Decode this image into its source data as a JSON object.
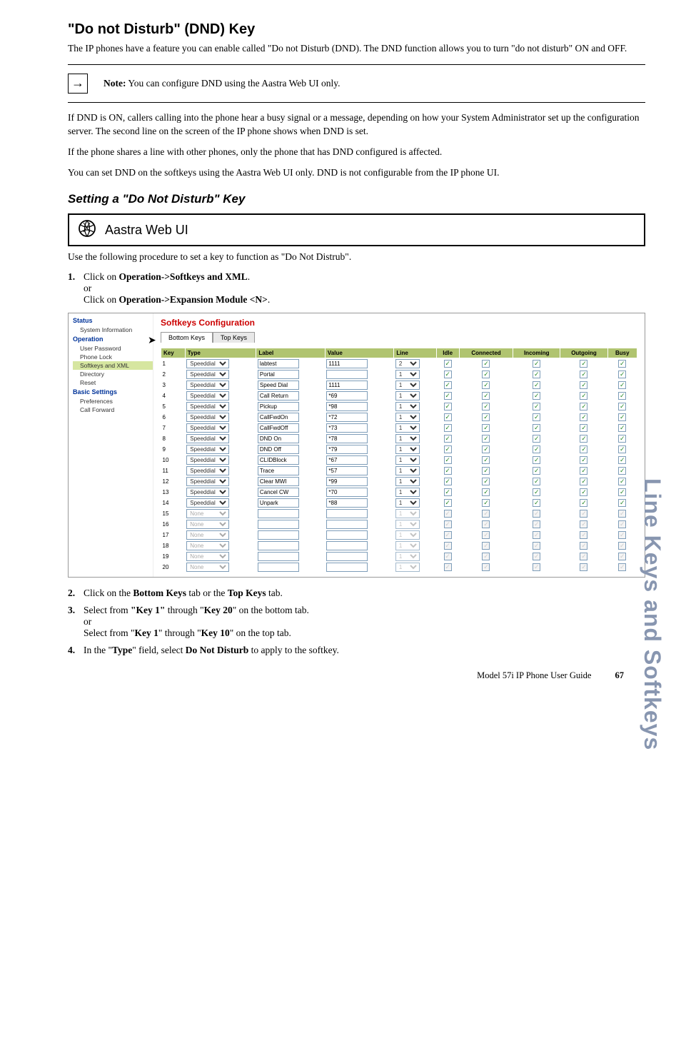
{
  "title": "\"Do not Disturb\" (DND) Key",
  "intro": "The IP phones have a feature you can enable called \"Do not Disturb (DND). The DND function allows you to turn \"do not disturb\" ON and OFF.",
  "note_glyph": "→",
  "note_label": "Note:",
  "note_text": " You can configure DND using the Aastra Web UI only.",
  "p1": "If DND is ON, callers calling into the phone hear a busy signal or a message, depending on how your System Administrator set up the configuration server. The second line on the screen of the IP phone shows when DND is set.",
  "p2": "If the phone shares a line with other phones, only the phone that has DND configured is affected.",
  "p3": "You can set DND on the softkeys using the Aastra Web UI only. DND is not configurable from the IP phone UI.",
  "section1": "Setting a \"Do Not Disturb\" Key",
  "webui": "Aastra Web UI",
  "use_line": "Use the following procedure to set a key to function as \"Do Not Distrub\".",
  "step1_num": "1.",
  "step1a": "Click on ",
  "step1b": "Operation->Softkeys and XML",
  "step1c": ".",
  "or": "or",
  "step1d": "Click on ",
  "step1e": "Operation->Expansion Module <N>",
  "step1f": ".",
  "step2_num": "2.",
  "step2a": "Click on the ",
  "step2b": "Bottom Keys",
  "step2c": " tab or the ",
  "step2d": "Top Keys",
  "step2e": " tab.",
  "step3_num": "3.",
  "step3a": "Select from ",
  "step3b": "\"Key 1\"",
  "step3c": " through \"",
  "step3d": "Key 20",
  "step3e": "\" on the bottom tab.",
  "step3f": "Select from \"",
  "step3g": "Key 1",
  "step3h": "\" through \"",
  "step3i": "Key 10",
  "step3j": "\" on the top tab.",
  "step4_num": "4.",
  "step4a": "In the \"",
  "step4b": "Type",
  "step4c": "\" field, select ",
  "step4d": "Do Not Disturb",
  "step4e": " to apply to the softkey.",
  "side": "Line Keys and Softkeys",
  "footer_text": "Model 57i IP Phone User Guide",
  "footer_page": "67",
  "ss": {
    "title": "Softkeys Configuration",
    "tab1": "Bottom Keys",
    "tab2": "Top Keys",
    "nav": {
      "h1": "Status",
      "i1": "System Information",
      "h2": "Operation",
      "i2": "User Password",
      "i3": "Phone Lock",
      "i4": "Softkeys and XML",
      "i5": "Directory",
      "i6": "Reset",
      "h3": "Basic Settings",
      "i7": "Preferences",
      "i8": "Call Forward"
    },
    "headers": [
      "Key",
      "Type",
      "Label",
      "Value",
      "Line",
      "Idle",
      "Connected",
      "Incoming",
      "Outgoing",
      "Busy"
    ],
    "rows": [
      {
        "k": "1",
        "type": "Speeddial",
        "label": "labtest",
        "value": "1111",
        "line": "2",
        "en": true
      },
      {
        "k": "2",
        "type": "Speeddial",
        "label": "Portal",
        "value": "",
        "line": "1",
        "en": true
      },
      {
        "k": "3",
        "type": "Speeddial",
        "label": "Speed Dial",
        "value": "1111",
        "line": "1",
        "en": true
      },
      {
        "k": "4",
        "type": "Speeddial",
        "label": "Call Return",
        "value": "*69",
        "line": "1",
        "en": true
      },
      {
        "k": "5",
        "type": "Speeddial",
        "label": "Pickup",
        "value": "*98",
        "line": "1",
        "en": true
      },
      {
        "k": "6",
        "type": "Speeddial",
        "label": "CallFwdOn",
        "value": "*72",
        "line": "1",
        "en": true
      },
      {
        "k": "7",
        "type": "Speeddial",
        "label": "CallFwdOff",
        "value": "*73",
        "line": "1",
        "en": true
      },
      {
        "k": "8",
        "type": "Speeddial",
        "label": "DND On",
        "value": "*78",
        "line": "1",
        "en": true
      },
      {
        "k": "9",
        "type": "Speeddial",
        "label": "DND Off",
        "value": "*79",
        "line": "1",
        "en": true
      },
      {
        "k": "10",
        "type": "Speeddial",
        "label": "CLIDBlock",
        "value": "*67",
        "line": "1",
        "en": true
      },
      {
        "k": "11",
        "type": "Speeddial",
        "label": "Trace",
        "value": "*57",
        "line": "1",
        "en": true
      },
      {
        "k": "12",
        "type": "Speeddial",
        "label": "Clear MWI",
        "value": "*99",
        "line": "1",
        "en": true
      },
      {
        "k": "13",
        "type": "Speeddial",
        "label": "Cancel CW",
        "value": "*70",
        "line": "1",
        "en": true
      },
      {
        "k": "14",
        "type": "Speeddial",
        "label": "Unpark",
        "value": "*88",
        "line": "1",
        "en": true
      },
      {
        "k": "15",
        "type": "None",
        "label": "",
        "value": "",
        "line": "1",
        "en": false
      },
      {
        "k": "16",
        "type": "None",
        "label": "",
        "value": "",
        "line": "1",
        "en": false
      },
      {
        "k": "17",
        "type": "None",
        "label": "",
        "value": "",
        "line": "1",
        "en": false
      },
      {
        "k": "18",
        "type": "None",
        "label": "",
        "value": "",
        "line": "1",
        "en": false
      },
      {
        "k": "19",
        "type": "None",
        "label": "",
        "value": "",
        "line": "1",
        "en": false
      },
      {
        "k": "20",
        "type": "None",
        "label": "",
        "value": "",
        "line": "1",
        "en": false
      }
    ]
  }
}
